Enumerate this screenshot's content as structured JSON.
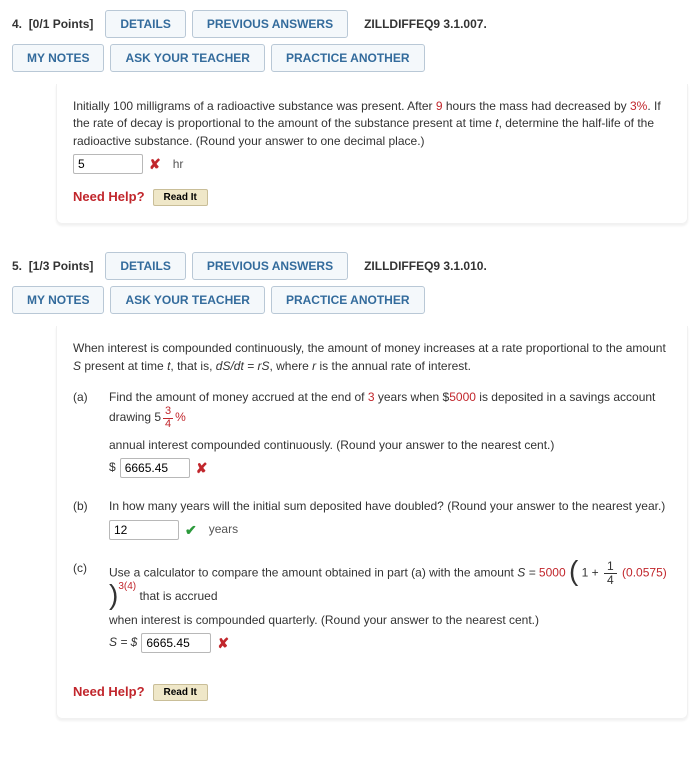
{
  "buttons": {
    "details": "DETAILS",
    "previous": "PREVIOUS ANSWERS",
    "notes": "MY NOTES",
    "ask": "ASK YOUR TEACHER",
    "practice": "PRACTICE ANOTHER"
  },
  "need_help": {
    "label": "Need Help?",
    "read_it": "Read It"
  },
  "q4": {
    "number": "4.",
    "points": "[0/1 Points]",
    "ref": "ZILLDIFFEQ9 3.1.007.",
    "text1": "Initially 100 milligrams of a radioactive substance was present. After ",
    "after_hours": "9",
    "text2": " hours the mass had decreased by ",
    "percent": "3%",
    "text3": ". If the rate of decay is proportional to the amount of the substance present at time ",
    "var_t": "t",
    "text4": ", determine the half-life of the radioactive substance. (Round your answer to one decimal place.)",
    "answer": "5",
    "unit": "hr"
  },
  "q5": {
    "number": "5.",
    "points": "[1/3 Points]",
    "ref": "ZILLDIFFEQ9 3.1.010.",
    "intro1": "When interest is compounded continuously, the amount of money increases at a rate proportional to the amount ",
    "var_S": "S",
    "intro2": " present at time ",
    "var_t": "t",
    "intro3": ", that is, ",
    "eq": "dS/dt = rS",
    "intro4": ", where ",
    "var_r": "r",
    "intro5": " is the annual rate of interest.",
    "a": {
      "label": "(a)",
      "text1": "Find the amount of money accrued at the end of ",
      "years": "3",
      "text2": " years when $",
      "deposit": "5000",
      "text3": " is deposited in a savings account drawing 5",
      "frac_num": "3",
      "frac_den": "4",
      "text4": "%",
      "text5": "annual interest compounded continuously. (Round your answer to the nearest cent.)",
      "answer": "6665.45"
    },
    "b": {
      "label": "(b)",
      "text": "In how many years will the initial sum deposited have doubled? (Round your answer to the nearest year.)",
      "answer": "12",
      "unit": "years"
    },
    "c": {
      "label": "(c)",
      "text1": "Use a calculator to compare the amount obtained in part (a) with the amount ",
      "eqS": "S = ",
      "base": "5000",
      "one": "1",
      "plus": " + ",
      "frac_num": "1",
      "frac_den": "4",
      "rate": "(0.0575)",
      "exp": "3(4)",
      "text2": " that is accrued",
      "text3": "when interest is compounded quarterly. (Round your answer to the nearest cent.)",
      "prefix": "S = $",
      "answer": "6665.45"
    }
  }
}
